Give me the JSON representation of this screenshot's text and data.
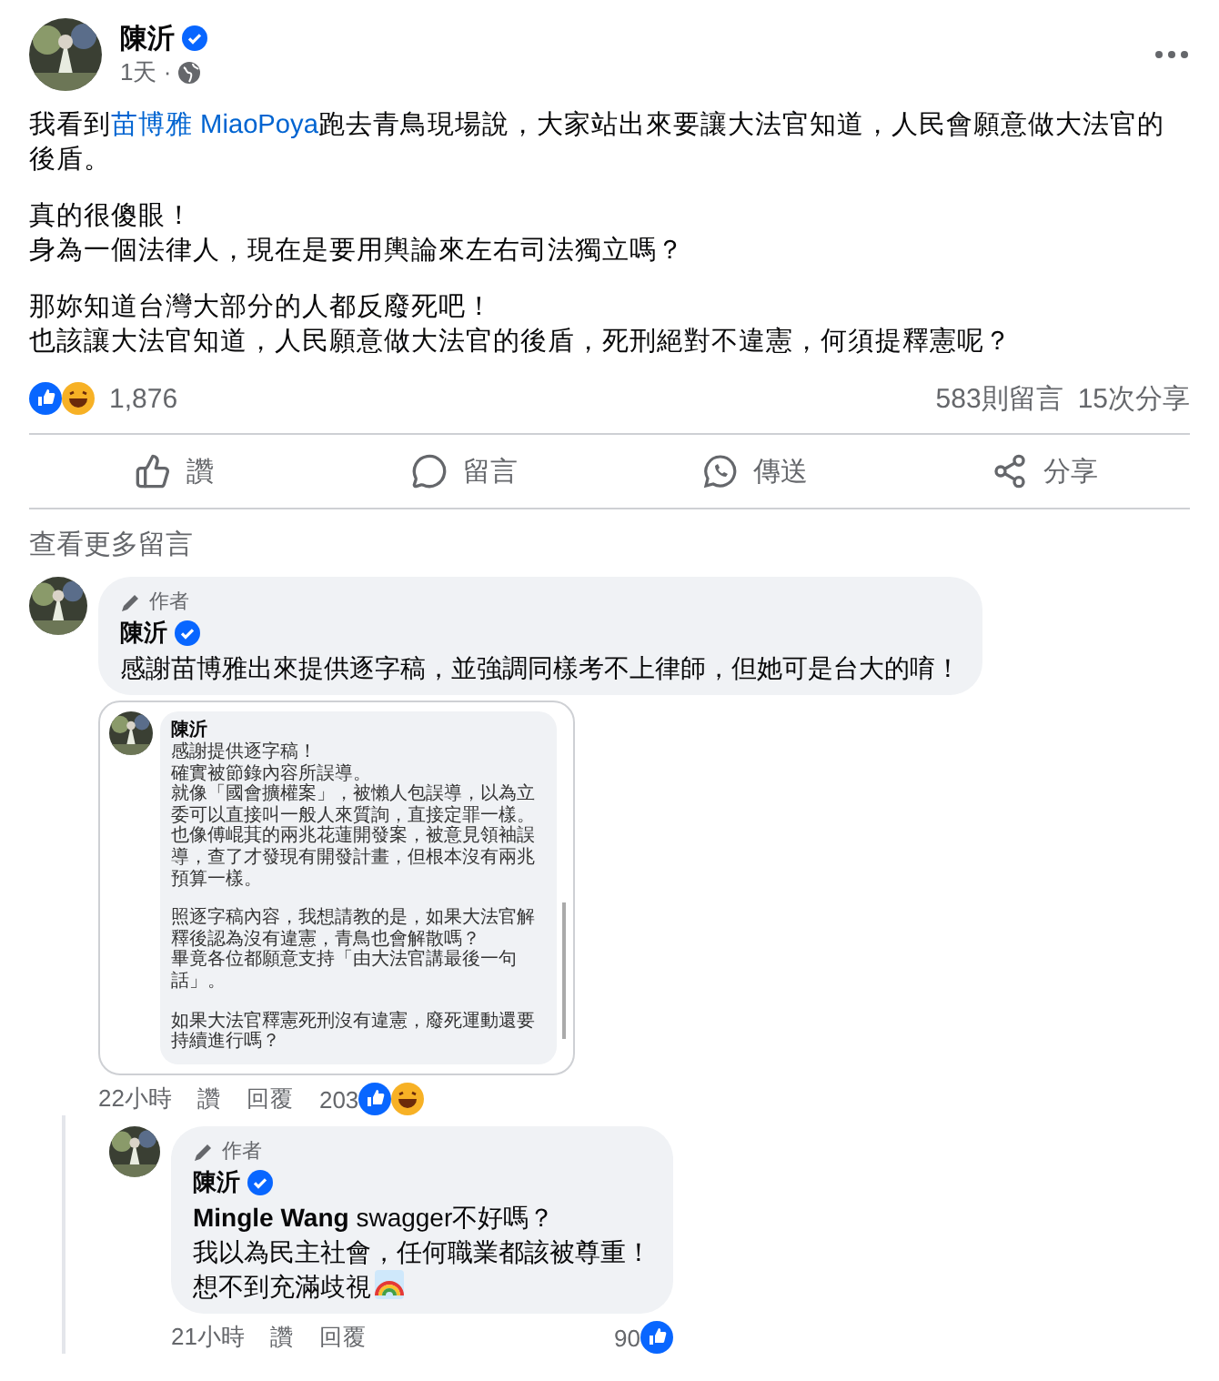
{
  "post": {
    "author": "陳沂",
    "verified": true,
    "time": "1天 ·",
    "paragraphs": [
      [
        {
          "kind": "text",
          "text": "我看到"
        },
        {
          "kind": "link",
          "text": "苗博雅 MiaoPoya"
        },
        {
          "kind": "text",
          "text": "跑去青鳥現場說，大家站出來要讓大法官知道，人民會願意做大法官的後盾。"
        }
      ],
      [
        {
          "kind": "text",
          "text": "真的很傻眼！"
        }
      ],
      [
        {
          "kind": "text",
          "text": "身為一個法律人，現在是要用輿論來左右司法獨立嗎？"
        }
      ],
      [
        {
          "kind": "text",
          "text": "那妳知道台灣大部分的人都反廢死吧！"
        }
      ],
      [
        {
          "kind": "text",
          "text": "也該讓大法官知道，人民願意做大法官的後盾，死刑絕對不違憲，何須提釋憲呢？"
        }
      ]
    ],
    "reaction_count": "1,876",
    "comment_count": "583則留言",
    "share_count": "15次分享"
  },
  "actions": [
    {
      "kind": "like",
      "label": "讚"
    },
    {
      "kind": "comment",
      "label": "留言"
    },
    {
      "kind": "send",
      "label": "傳送"
    },
    {
      "kind": "share",
      "label": "分享"
    }
  ],
  "more_comments": "查看更多留言",
  "comment": {
    "badge": "作者",
    "author": "陳沂",
    "verified": true,
    "text": "感謝苗博雅出來提供逐字稿，並強調同樣考不上律師，但她可是台大的唷！",
    "attachment": {
      "author": "陳沂",
      "lines": [
        "感謝提供逐字稿！",
        "確實被節錄內容所誤導。",
        "就像「國會擴權案」，被懶人包誤導，以為立委可以直接叫一般人來質詢，直接定罪一樣。",
        "也像傅崐萁的兩兆花蓮開發案，被意見領袖誤導，查了才發現有開發計畫，但根本沒有兩兆預算一樣。",
        "照逐字稿內容，我想請教的是，如果大法官解釋後認為沒有違憲，青鳥也會解散嗎？",
        "畢竟各位都願意支持「由大法官講最後一句話」。",
        "如果大法官釋憲死刑沒有違憲，廢死運動還要持續進行嗎？"
      ]
    },
    "time": "22小時",
    "like": "讚",
    "reply": "回覆",
    "reaction_count": "203",
    "reply_comment": {
      "badge": "作者",
      "author": "陳沂",
      "verified": true,
      "lines": [
        "**Mingle Wang** swagger不好嗎？",
        "我以為民主社會，任何職業都該被尊重！",
        "想不到充滿歧視"
      ],
      "time": "21小時",
      "like": "讚",
      "reply": "回覆",
      "reaction_count": "90"
    }
  }
}
